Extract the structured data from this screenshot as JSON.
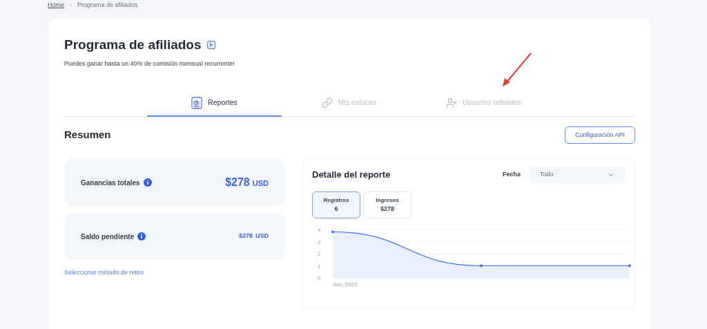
{
  "breadcrumb": {
    "home": "Home",
    "separator": "›",
    "current": "Programa de afiliados"
  },
  "header": {
    "title": "Programa de afiliados",
    "subtitle": "Puedes ganar hasta un 40% de comisión mensual recurrente!"
  },
  "tabs": [
    {
      "label": "Reportes",
      "kind": "report",
      "selected": true
    },
    {
      "label": "Mis enlaces",
      "kind": "link",
      "selected": false
    },
    {
      "label": "Usuarios referidos",
      "kind": "users",
      "selected": false
    }
  ],
  "summary": {
    "title": "Resumen",
    "api_button": "Configuración API",
    "cards": [
      {
        "label": "Ganancias totales",
        "amount": "$278",
        "currency": "USD",
        "kind": "large"
      },
      {
        "label": "Saldo pendiente",
        "amount": "$278",
        "currency": "USD",
        "kind": "small"
      }
    ],
    "withdraw_link": "Seleccionar método de retiro"
  },
  "report": {
    "title": "Detalle del reporte",
    "date_label": "Fecha",
    "date_value": "Todo",
    "metrics": [
      {
        "label": "Registros",
        "value": "6",
        "selected": true
      },
      {
        "label": "Ingresos",
        "value": "$278",
        "selected": false
      }
    ],
    "chart": {
      "y_labels": [
        "4",
        "3",
        "2",
        "1",
        "0"
      ],
      "x_label": "Jun, 2022"
    }
  }
}
